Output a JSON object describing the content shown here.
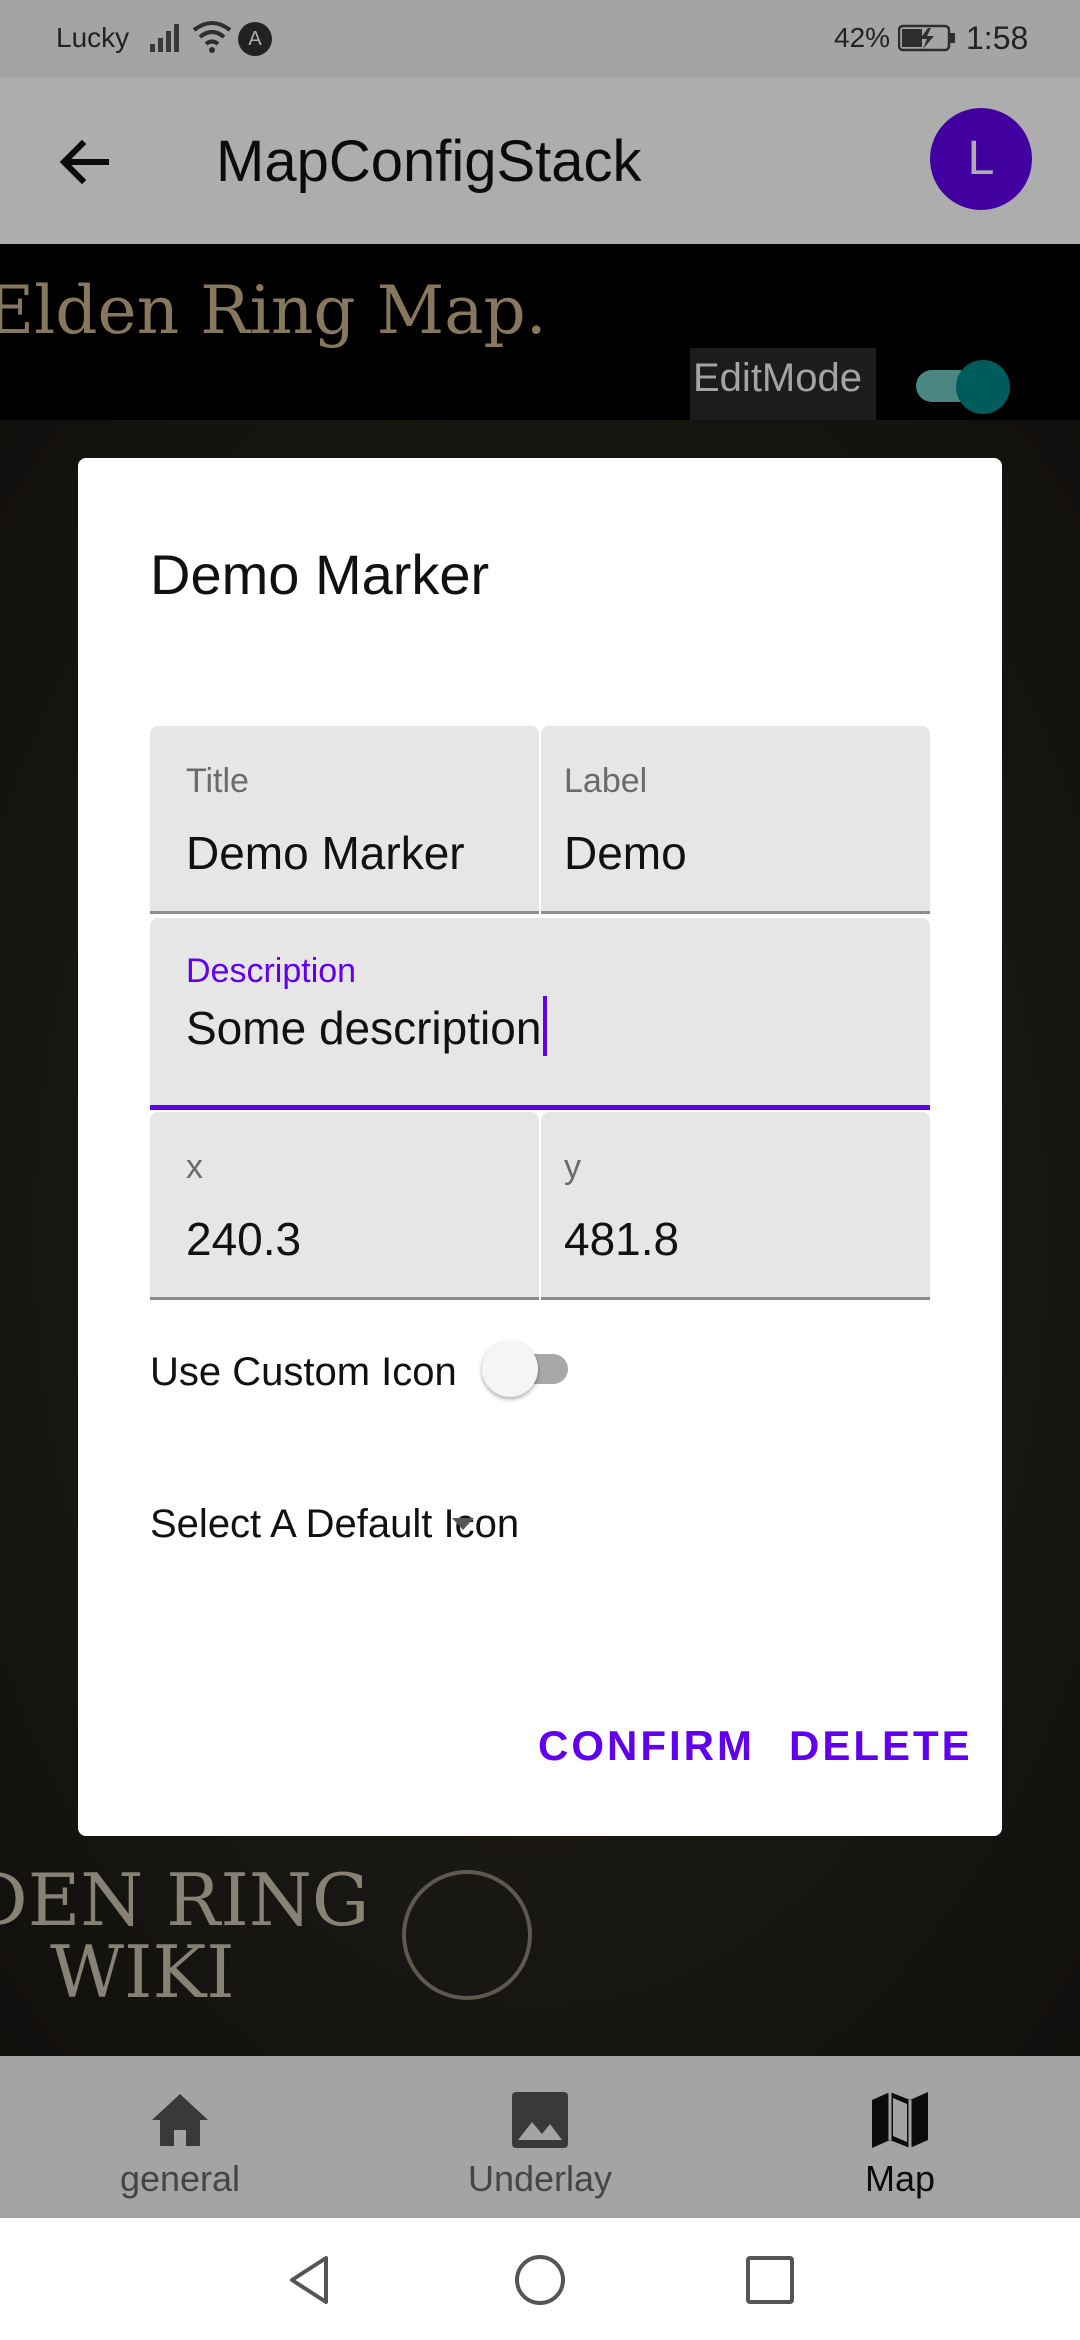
{
  "status_bar": {
    "carrier": "Lucky",
    "battery_percent": "42%",
    "time": "1:58",
    "app_notification_icon": "A"
  },
  "app_bar": {
    "title": "MapConfigStack",
    "avatar_letter": "L"
  },
  "map": {
    "title": "Elden Ring Map.",
    "edit_mode_label": "EditMode",
    "edit_mode_on": true,
    "bottom_text_line1": "DEN RING",
    "bottom_text_line2": "WIKI"
  },
  "dialog": {
    "title": "Demo Marker",
    "fields": {
      "title_label": "Title",
      "title_value": "Demo Marker",
      "label_label": "Label",
      "label_value": "Demo",
      "description_label": "Description",
      "description_value": "Some description",
      "x_label": "x",
      "x_value": "240.3",
      "y_label": "y",
      "y_value": "481.8"
    },
    "custom_icon_label": "Use Custom Icon",
    "custom_icon_on": false,
    "select_icon_label": "Select A Default Icon",
    "confirm_label": "CONFIRM",
    "delete_label": "DELETE"
  },
  "bottom_nav": {
    "items": [
      {
        "label": "general",
        "icon": "home-icon"
      },
      {
        "label": "Underlay",
        "icon": "image-icon"
      },
      {
        "label": "Map",
        "icon": "map-icon"
      }
    ],
    "active": "Map"
  },
  "colors": {
    "primary": "#6200ee",
    "secondary": "#018786",
    "field_bg": "#e6e6e6"
  }
}
